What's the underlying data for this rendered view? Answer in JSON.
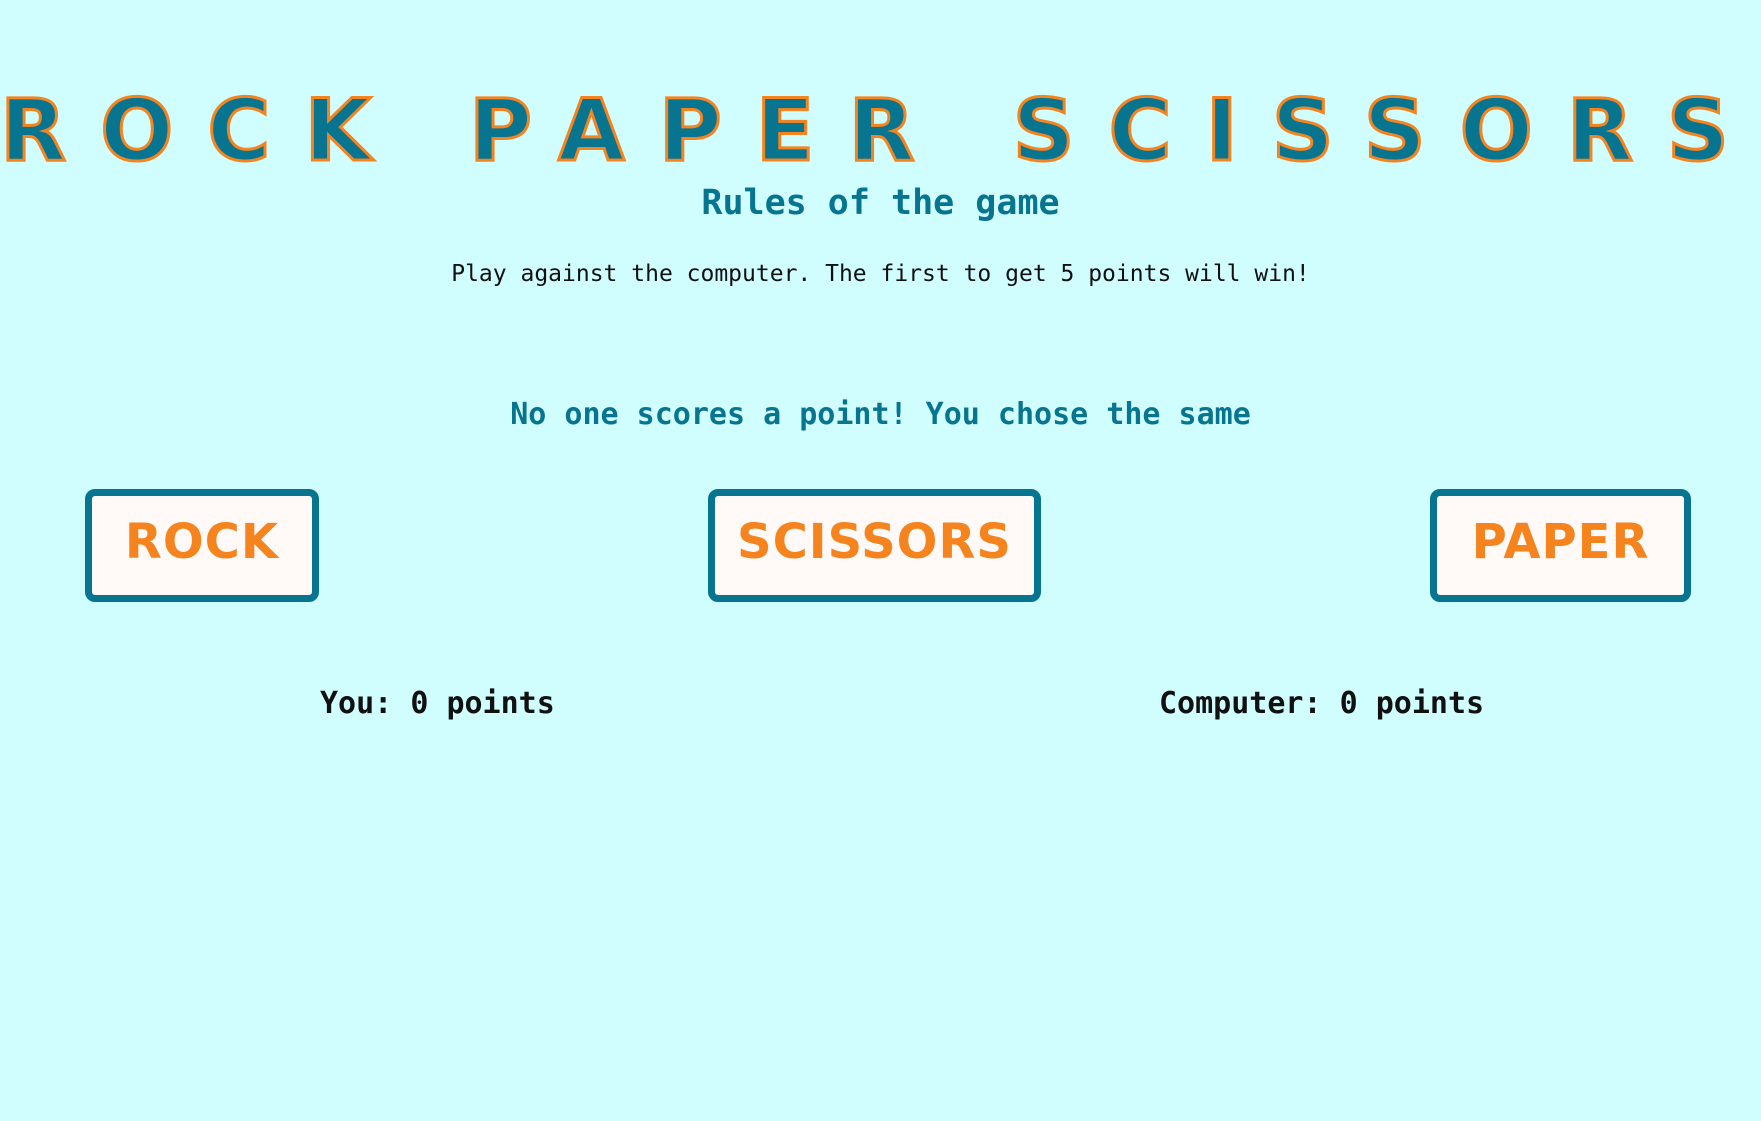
{
  "header": {
    "title": "Rock Paper Scissors"
  },
  "rules": {
    "heading": "Rules of the game",
    "text": "Play against the computer. The first to get 5 points will win!"
  },
  "status": {
    "message": "No one scores a point! You chose the same"
  },
  "choices": [
    {
      "label": "Rock"
    },
    {
      "label": "Scissors"
    },
    {
      "label": "Paper"
    }
  ],
  "scores": {
    "player_label": "You:",
    "player_points": "0",
    "computer_label": "Computer:",
    "computer_points": "0",
    "unit": "points"
  },
  "colors": {
    "background": "#d0fdfd",
    "primary": "#077490",
    "accent": "#f5841f",
    "button_fill": "#fff9f8"
  }
}
